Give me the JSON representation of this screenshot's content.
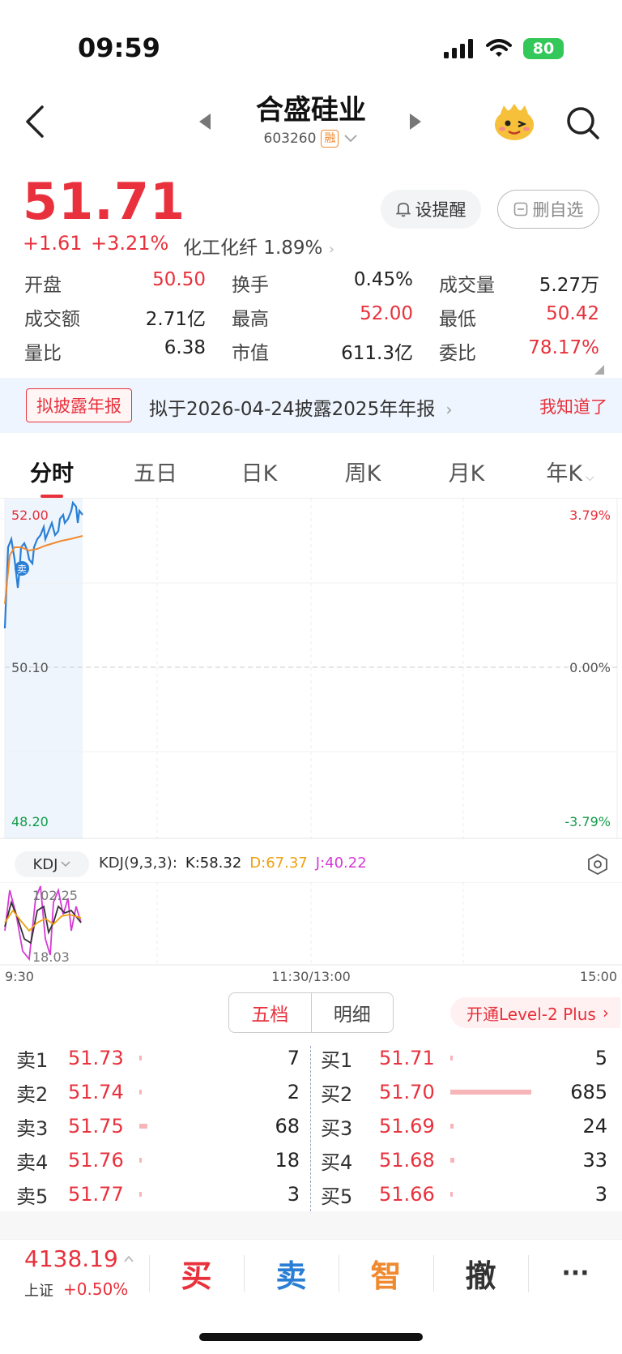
{
  "status": {
    "time": "09:59",
    "battery": "80"
  },
  "header": {
    "title": "合盛硅业",
    "code": "603260",
    "margin_tag": "融"
  },
  "quote": {
    "price": "51.71",
    "change": "+1.61",
    "change_pct": "+3.21%",
    "sector": "化工化纤 1.89%",
    "alert_label": "设提醒",
    "watch_label": "删自选"
  },
  "stats": [
    [
      {
        "label": "开盘",
        "value": "50.50",
        "color": "red"
      },
      {
        "label": "换手",
        "value": "0.45%",
        "color": "dark"
      },
      {
        "label": "成交量",
        "value": "5.27万",
        "color": "dark"
      }
    ],
    [
      {
        "label": "成交额",
        "value": "2.71亿",
        "color": "dark"
      },
      {
        "label": "最高",
        "value": "52.00",
        "color": "red"
      },
      {
        "label": "最低",
        "value": "50.42",
        "color": "red"
      }
    ],
    [
      {
        "label": "量比",
        "value": "6.38",
        "color": "dark"
      },
      {
        "label": "市值",
        "value": "611.3亿",
        "color": "dark"
      },
      {
        "label": "委比",
        "value": "78.17%",
        "color": "red"
      }
    ]
  ],
  "banner": {
    "tag": "拟披露年报",
    "text": "拟于2026-04-24披露2025年年报",
    "dismiss": "我知道了"
  },
  "tabs": [
    "分时",
    "五日",
    "日K",
    "周K",
    "月K",
    "年K"
  ],
  "chart": {
    "price_high": "52.00",
    "price_mid": "50.10",
    "price_low": "48.20",
    "pct_high": "3.79%",
    "pct_mid": "0.00%",
    "pct_low": "-3.79%",
    "sell_marker": "卖",
    "time_start": "9:30",
    "time_mid": "11:30/13:00",
    "time_end": "15:00"
  },
  "kdj": {
    "indicator": "KDJ",
    "params": "KDJ(9,3,3):",
    "k": "K:58.32",
    "d": "D:67.37",
    "j": "J:40.22",
    "max": "102.25",
    "min": "18.03",
    "colors": {
      "k": "#222222",
      "d": "#f0a010",
      "j": "#d63ad6"
    }
  },
  "orderbook": {
    "tab_active": "五档",
    "tab_other": "明细",
    "level2_label": "开通Level-2 Plus",
    "sell": [
      {
        "label": "卖1",
        "price": "51.73",
        "vol": "7",
        "bar": 7
      },
      {
        "label": "卖2",
        "price": "51.74",
        "vol": "2",
        "bar": 2
      },
      {
        "label": "卖3",
        "price": "51.75",
        "vol": "68",
        "bar": 68
      },
      {
        "label": "卖4",
        "price": "51.76",
        "vol": "18",
        "bar": 18
      },
      {
        "label": "卖5",
        "price": "51.77",
        "vol": "3",
        "bar": 3
      }
    ],
    "buy": [
      {
        "label": "买1",
        "price": "51.71",
        "vol": "5",
        "bar": 5
      },
      {
        "label": "买2",
        "price": "51.70",
        "vol": "685",
        "bar": 685
      },
      {
        "label": "买3",
        "price": "51.69",
        "vol": "24",
        "bar": 24
      },
      {
        "label": "买4",
        "price": "51.68",
        "vol": "33",
        "bar": 33
      },
      {
        "label": "买5",
        "price": "51.66",
        "vol": "3",
        "bar": 3
      }
    ]
  },
  "bottom": {
    "index_value": "4138.19",
    "index_name": "上证",
    "index_change": "+0.50%",
    "buy": "买",
    "sell": "卖",
    "smart": "智",
    "cancel": "撤",
    "more": "···"
  },
  "colors": {
    "up": "#e8313c",
    "down": "#149c4a",
    "line": "#2a7fd4",
    "avg": "#f08a30",
    "buy_btn": "#e8313c",
    "sell_btn": "#2a7fd4",
    "smart_btn": "#f08a30",
    "cancel_btn": "#333333"
  }
}
